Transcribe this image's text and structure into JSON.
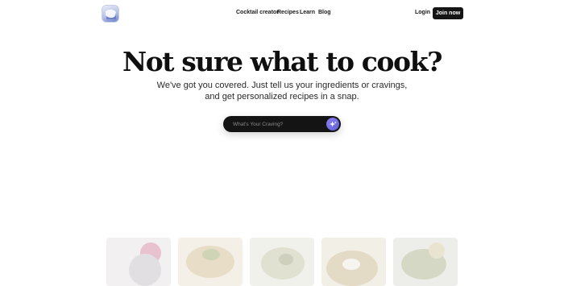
{
  "nav": {
    "logo_name": "app-logo",
    "links": [
      "Cocktail creator",
      "Recipes",
      "Learn",
      "Blog"
    ],
    "login_label": "Login",
    "join_label": "Join now"
  },
  "hero": {
    "title": "Not sure what to cook?",
    "subtitle_line1": "We've got you covered. Just tell us your ingredients or cravings,",
    "subtitle_line2": "and get personalized recipes in a snap."
  },
  "search": {
    "placeholder": "What's Your Craving?",
    "button_icon": "sparkle-icon"
  },
  "cards": [
    {
      "name": "recipe-card-berries",
      "colors": [
        "#e8e4e6",
        "#c9a3b0",
        "#e0bcc8"
      ]
    },
    {
      "name": "recipe-card-pasta",
      "colors": [
        "#ece4d6",
        "#d5c39f",
        "#b9b58a"
      ]
    },
    {
      "name": "recipe-card-salad",
      "colors": [
        "#e5e6dc",
        "#bfc3a4",
        "#cfcfb8"
      ]
    },
    {
      "name": "recipe-card-bowl",
      "colors": [
        "#e9e2d3",
        "#c8b68a",
        "#a5a78a"
      ]
    },
    {
      "name": "recipe-card-herbs",
      "colors": [
        "#dfe1d8",
        "#a9b294",
        "#c6c1a2"
      ]
    }
  ]
}
